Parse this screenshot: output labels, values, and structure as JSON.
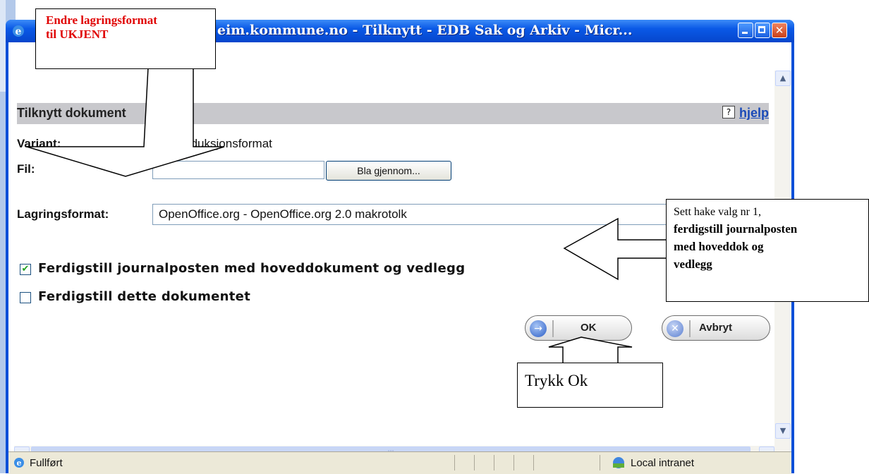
{
  "window": {
    "title": "eim.kommune.no - Tilknytt - EDB Sak og Arkiv - Micr..."
  },
  "form": {
    "header": "Tilknytt dokument",
    "help_link": "hjelp",
    "variant_label": "Variant:",
    "variant_value": "P - Produksjonsformat",
    "file_label": "Fil:",
    "file_value": "",
    "browse_button": "Bla gjennom...",
    "format_label": "Lagringsformat:",
    "format_selected": "OpenOffice.org - OpenOffice.org 2.0 makrotolk",
    "checkbox1": {
      "label": "Ferdigstill journalposten med hoveddokument og vedlegg",
      "checked": true
    },
    "checkbox2": {
      "label": "Ferdigstill dette dokumentet",
      "checked": false
    },
    "ok_button": "OK",
    "cancel_button": "Avbryt"
  },
  "statusbar": {
    "status": "Fullført",
    "zone": "Local intranet"
  },
  "callouts": {
    "top_left_line1": "Endre lagringsformat",
    "top_left_line2": "til UKJENT",
    "right_line1": "Sett hake valg nr 1,",
    "right_line2": "ferdigstill journalposten",
    "right_line3": "med hoveddok og",
    "right_line4": "vedlegg",
    "bottom": "Trykk Ok"
  },
  "colors": {
    "title_bar": "#0a59e6",
    "callout_red_text": "#e00000",
    "link": "#1a4ab8"
  }
}
